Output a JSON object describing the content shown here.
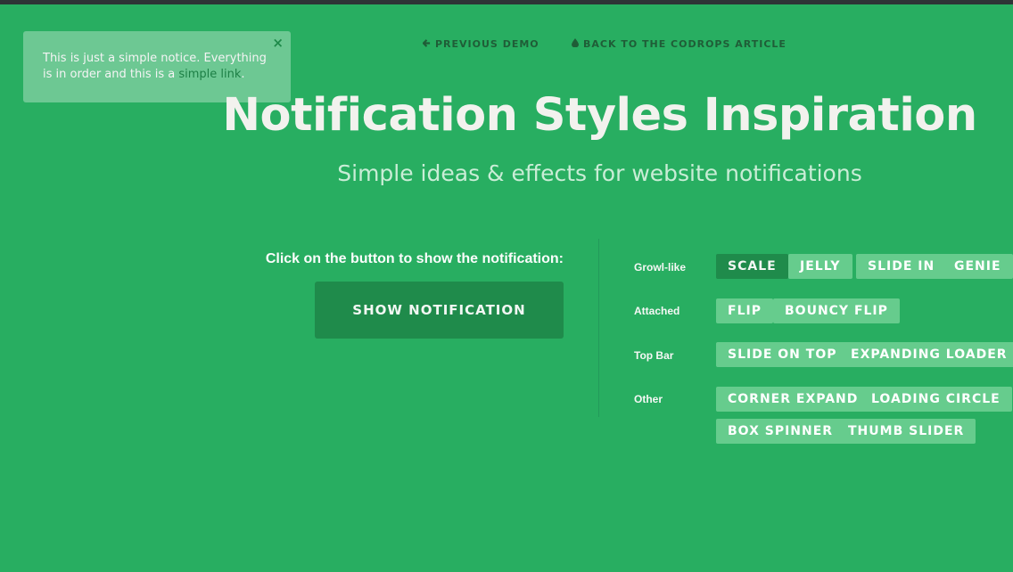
{
  "notice": {
    "text_before": "This is just a simple notice. Everything is in order and this is a ",
    "link_text": "simple link",
    "text_after": ".",
    "close_glyph": "×"
  },
  "nav": {
    "prev_icon": "arrow-left-icon",
    "prev_label": "PREVIOUS DEMO",
    "back_icon": "droplet-icon",
    "back_label": "BACK TO THE CODROPS ARTICLE"
  },
  "header": {
    "title": "Notification Styles Inspiration",
    "subtitle": "Simple ideas & effects for website notifications"
  },
  "left": {
    "instruction": "Click on the button to show the notification:",
    "show_label": "SHOW NOTIFICATION"
  },
  "effects": {
    "growl_label": "Growl-like",
    "growl": [
      "SCALE",
      "JELLY",
      "SLIDE IN",
      "GENIE"
    ],
    "attached_label": "Attached",
    "attached": [
      "FLIP",
      "BOUNCY FLIP"
    ],
    "topbar_label": "Top Bar",
    "topbar": [
      "SLIDE ON TOP",
      "EXPANDING LOADER"
    ],
    "other_label": "Other",
    "other": [
      "CORNER EXPAND",
      "LOADING CIRCLE",
      "BOX SPINNER",
      "THUMB SLIDER"
    ],
    "active": "SCALE"
  },
  "colors": {
    "background": "#28ae61",
    "button_dark": "#1f8b4b",
    "button_light": "#66cc8d",
    "nav_text": "#1f5d37"
  }
}
